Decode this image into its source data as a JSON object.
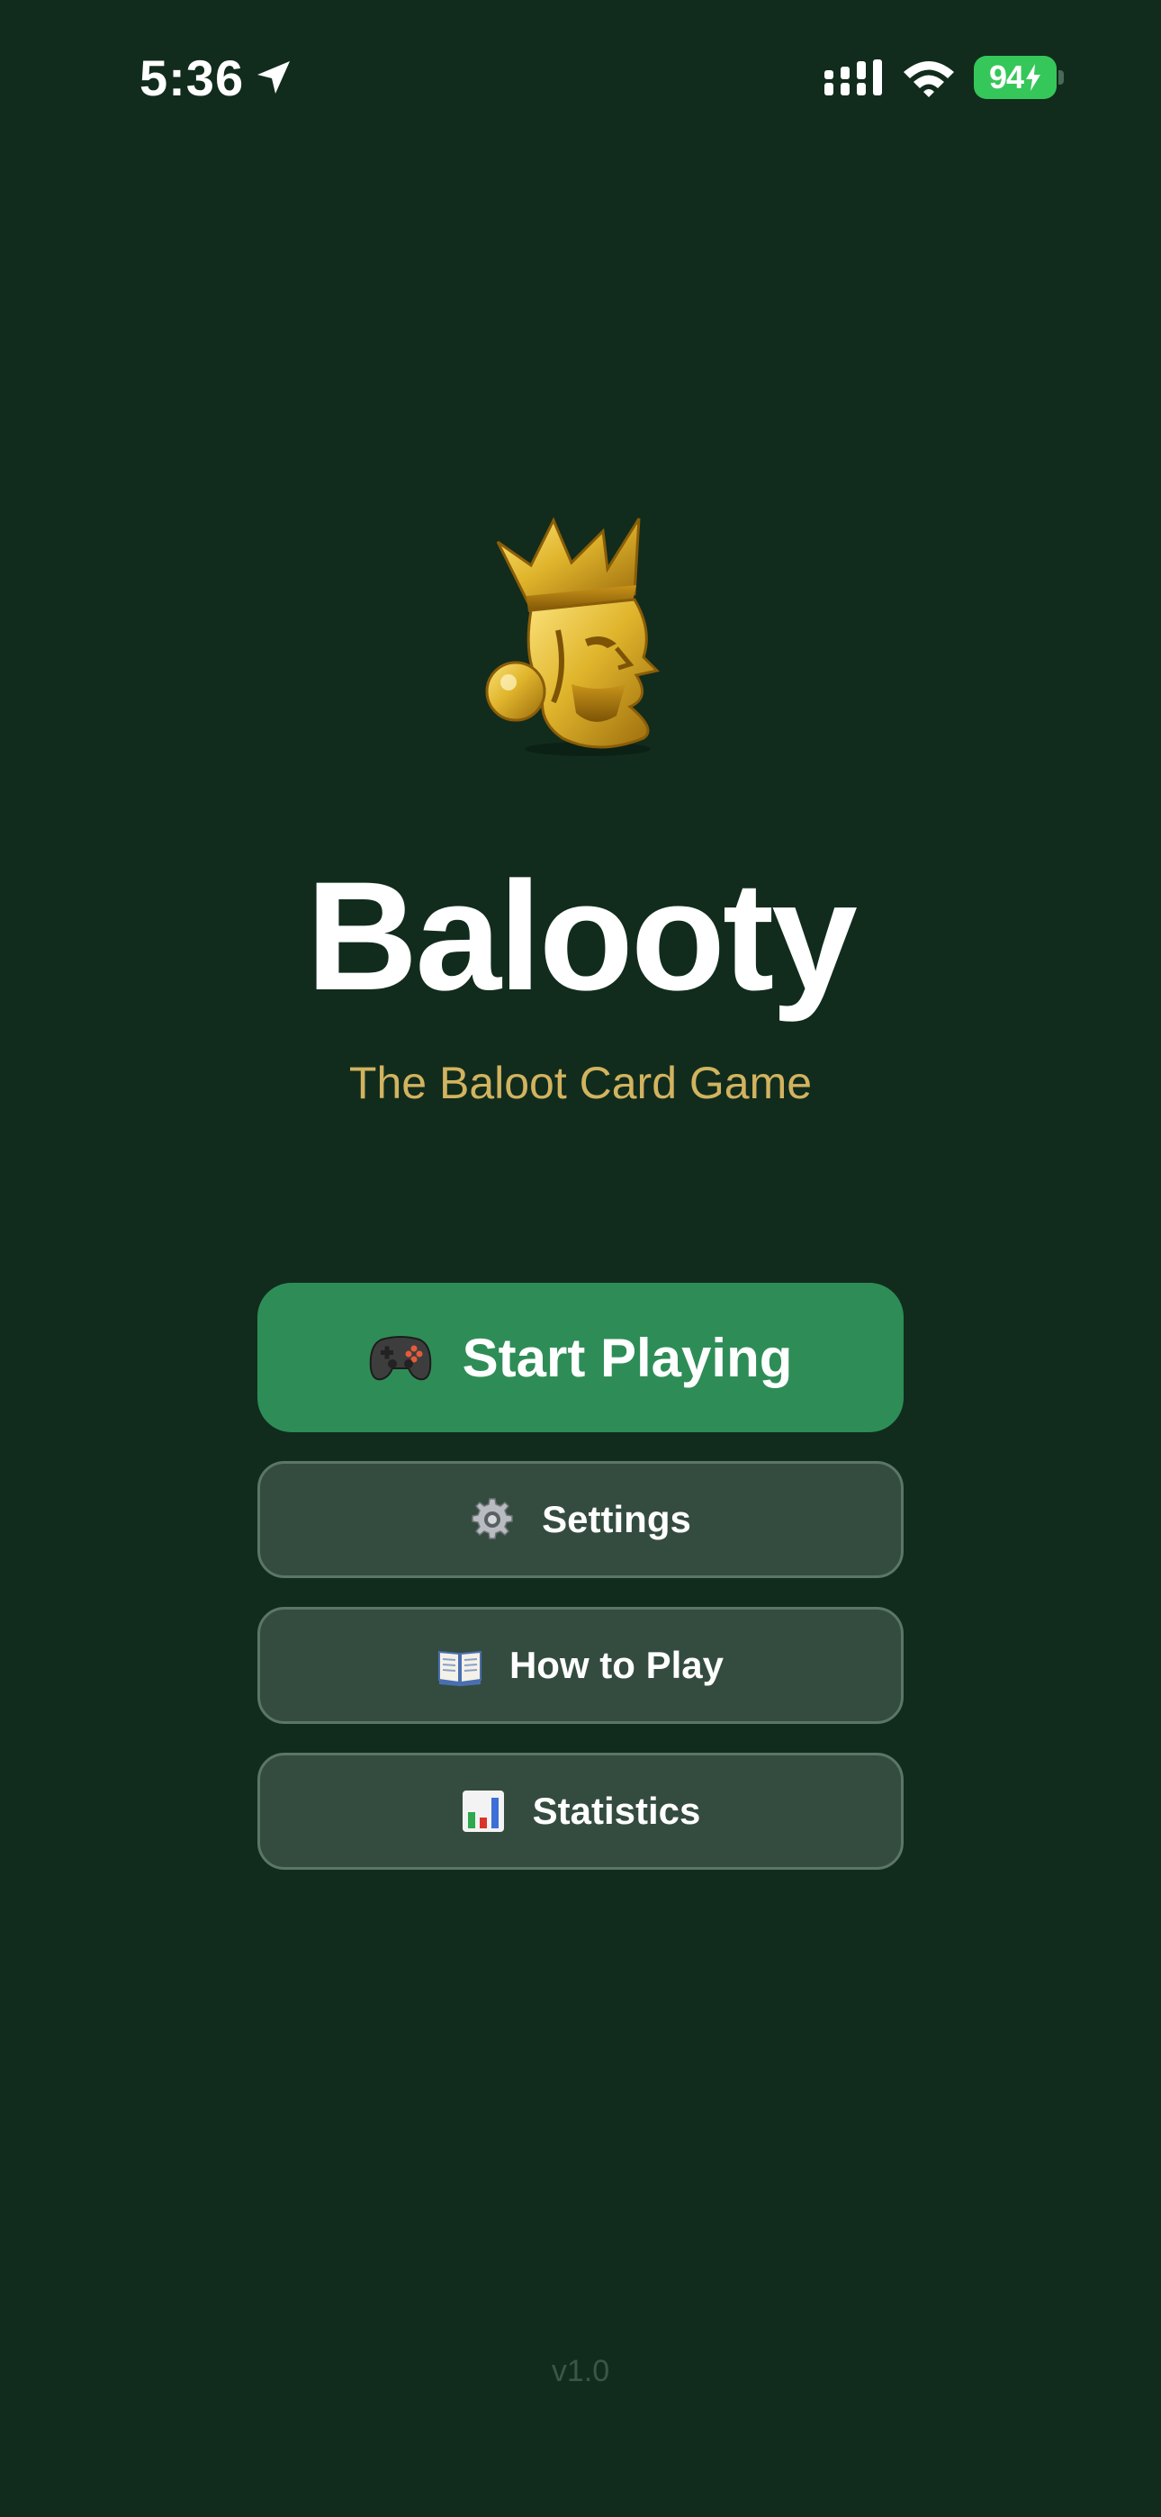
{
  "status_bar": {
    "time": "5:36",
    "battery_level": "94",
    "battery_charging": true,
    "icons": [
      "location-arrow-icon",
      "signal-icon",
      "wifi-icon",
      "battery-icon"
    ]
  },
  "app": {
    "logo": "crowned-king-icon",
    "title": "Balooty",
    "subtitle": "The Baloot Card Game"
  },
  "menu": {
    "start_label": "Start Playing",
    "start_icon": "gamepad-icon",
    "settings_label": "Settings",
    "settings_icon": "gear-icon",
    "howto_label": "How to Play",
    "howto_icon": "open-book-icon",
    "stats_label": "Statistics",
    "stats_icon": "bar-chart-icon"
  },
  "version": "v1.0",
  "colors": {
    "background": "#112c1d",
    "primary_button": "#2e8d57",
    "secondary_button": "#344c3f",
    "subtitle_gold": "#d2b35f",
    "battery_green": "#35c759"
  }
}
